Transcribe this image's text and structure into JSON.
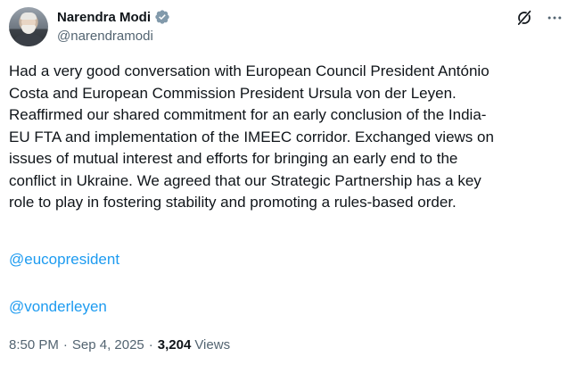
{
  "author": {
    "display_name": "Narendra Modi",
    "handle": "@narendramodi",
    "verified": true
  },
  "icons": {
    "verified": "verified-badge-icon",
    "grok": "grok-icon",
    "more": "more-options-icon"
  },
  "tweet": {
    "text": "Had a very good conversation with European Council President António\nCosta and European Commission President Ursula von der Leyen.\nReaffirmed our shared commitment for an early conclusion of the India-\nEU FTA and implementation of the IMEEC corridor. Exchanged views on\nissues of mutual interest and efforts for bringing an early end to the\nconflict in Ukraine. We agreed that our Strategic Partnership has a key\nrole to play in fostering stability and promoting a rules-based order.",
    "mentions": [
      "@eucopresident",
      "@vonderleyen"
    ]
  },
  "meta": {
    "time": "8:50 PM",
    "separator": "·",
    "date": "Sep 4, 2025",
    "views_count": "3,204",
    "views_label": "Views"
  },
  "colors": {
    "link": "#1d9bf0",
    "verified": "#829aab",
    "secondary_text": "#536471",
    "primary_text": "#0f1419"
  }
}
